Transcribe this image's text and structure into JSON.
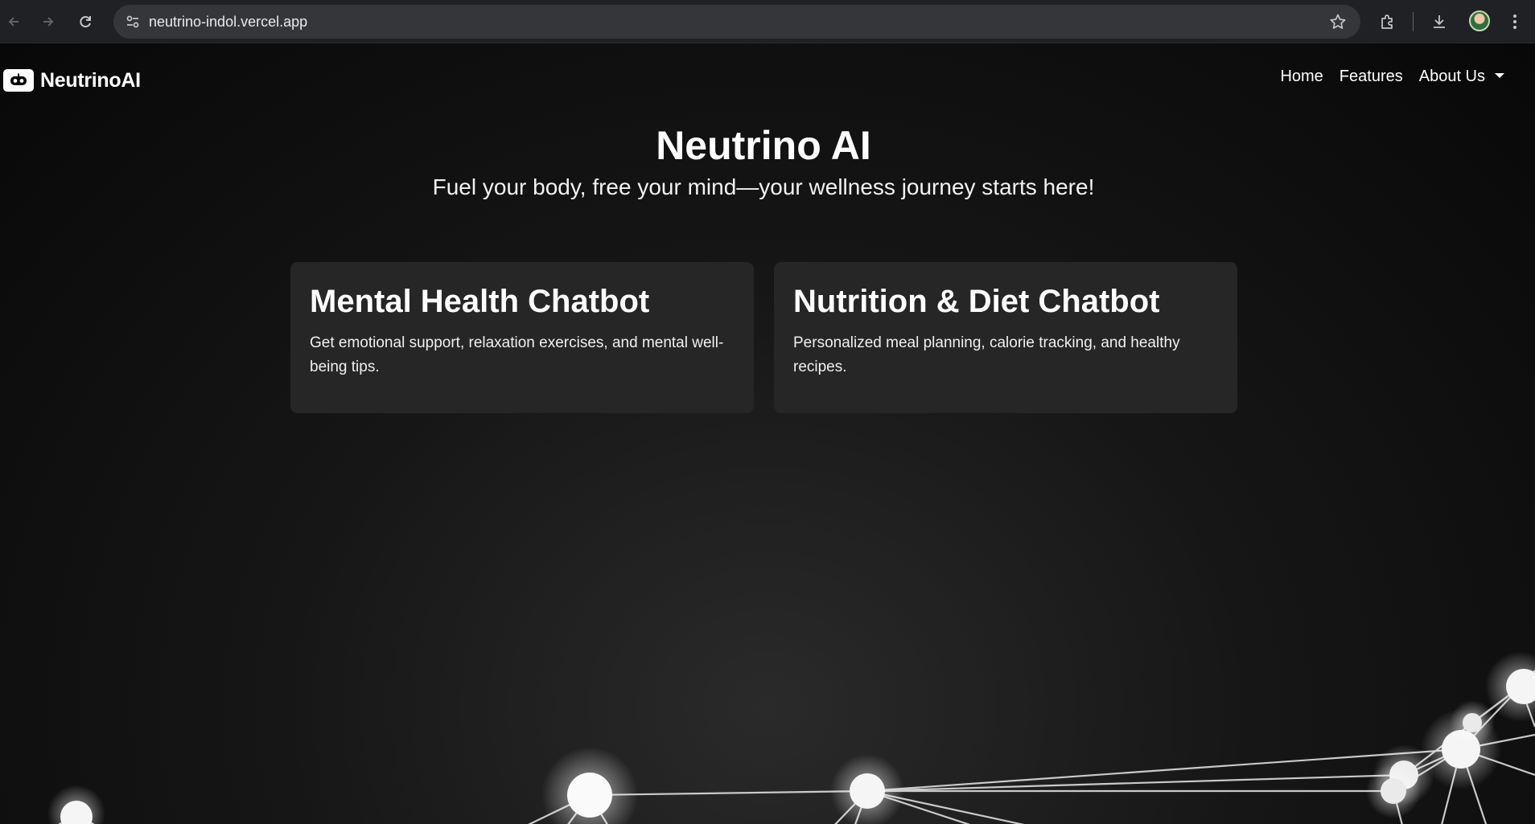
{
  "browser": {
    "url": "neutrino-indol.vercel.app",
    "icons": {
      "back": "arrow-left-icon",
      "forward": "arrow-right-icon",
      "reload": "reload-icon",
      "site_info": "tune-icon",
      "bookmark": "star-icon",
      "extensions": "puzzle-icon",
      "downloads": "download-icon",
      "profile": "avatar",
      "menu": "kebab-menu-icon"
    }
  },
  "navbar": {
    "brand": "NeutrinoAI",
    "brand_icon": "robot-icon",
    "links": {
      "home": "Home",
      "features": "Features",
      "about": "About Us"
    }
  },
  "hero": {
    "title": "Neutrino AI",
    "subtitle": "Fuel your body, free your mind—your wellness journey starts here!"
  },
  "cards": [
    {
      "title": "Mental Health Chatbot",
      "description": "Get emotional support, relaxation exercises, and mental well-being tips."
    },
    {
      "title": "Nutrition & Diet Chatbot",
      "description": "Personalized meal planning, calorie tracking, and healthy recipes."
    }
  ],
  "colors": {
    "background": "#000000",
    "card": "#262626",
    "text": "#ffffff",
    "chrome": "#202124",
    "omnibox": "#35363a"
  }
}
